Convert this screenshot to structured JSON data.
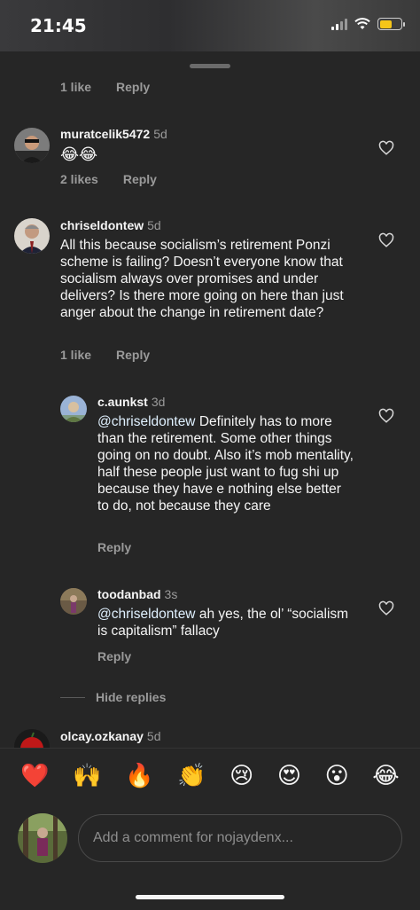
{
  "status_bar": {
    "time": "21:45",
    "signal_icon": "signal-icon",
    "wifi_icon": "wifi-icon",
    "battery_icon": "battery-icon",
    "battery_color": "#f5c518"
  },
  "comments": [
    {
      "actions": {
        "likes": "1 like",
        "reply": "Reply"
      }
    },
    {
      "username": "muratcelik5472",
      "time": "5d",
      "text": "😂😂",
      "actions": {
        "likes": "2 likes",
        "reply": "Reply"
      }
    },
    {
      "username": "chriseldontew",
      "time": "5d",
      "text": "All this because socialism’s retirement Ponzi scheme is failing?  Doesn’t everyone know that socialism always over promises and under delivers?  Is there more going on here than just anger about the change in retirement date?",
      "actions": {
        "likes": "1 like",
        "reply": "Reply"
      },
      "replies": [
        {
          "username": "c.aunkst",
          "time": "3d",
          "mention": "@chriseldontew",
          "text": " Definitely has to more than the retirement.  Some other things going on no doubt.  Also it’s mob mentality, half these people just want to fug shi up because they have e nothing else better to do, not because they care",
          "reply": "Reply"
        },
        {
          "username": "toodanbad",
          "time": "3s",
          "mention": "@chriseldontew",
          "text": " ah yes, the ol’ “socialism is capitalism” fallacy",
          "reply": "Reply"
        }
      ],
      "hide_replies": "Hide replies"
    },
    {
      "username": "olcay.ozkanay",
      "time": "5d"
    }
  ],
  "emoji_bar": [
    "❤️",
    "🙌",
    "🔥",
    "👏",
    "😢",
    "😍",
    "😮",
    "😂"
  ],
  "composer": {
    "placeholder": "Add a comment for nojaydenx..."
  }
}
